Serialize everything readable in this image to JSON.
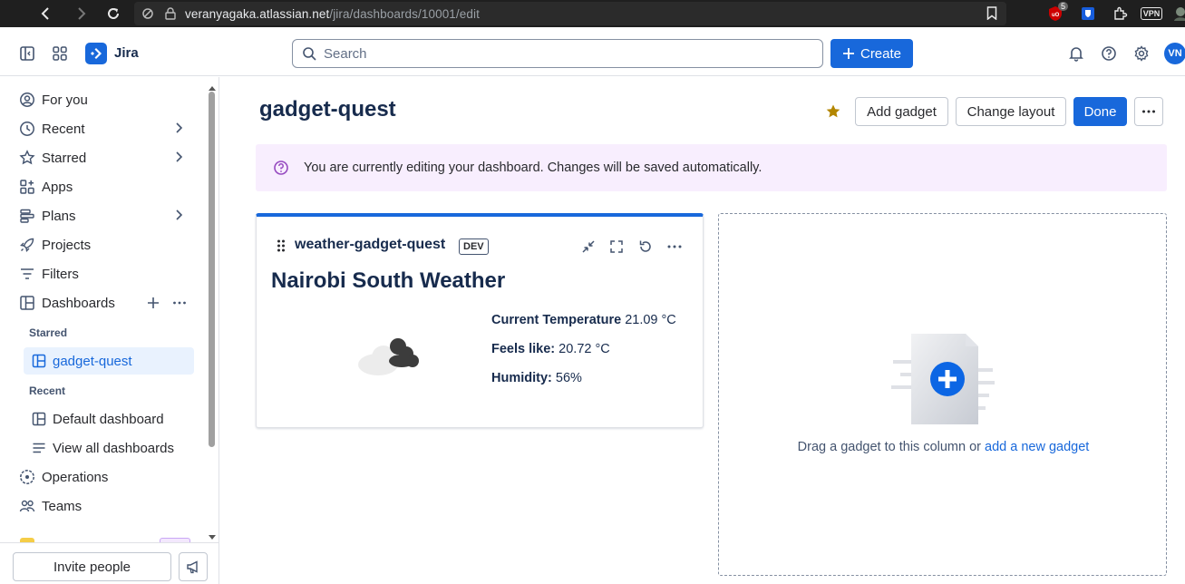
{
  "browser": {
    "url_host": "veranyagaka.atlassian.net",
    "url_path": "/jira/dashboards/10001/edit",
    "ext_badge": "5",
    "vpn_label": "VPN"
  },
  "topnav": {
    "app_name": "Jira",
    "search_placeholder": "Search",
    "create_label": "Create",
    "avatar_initials": "VN"
  },
  "sidebar": {
    "items": [
      {
        "label": "For you"
      },
      {
        "label": "Recent"
      },
      {
        "label": "Starred"
      },
      {
        "label": "Apps"
      },
      {
        "label": "Plans"
      },
      {
        "label": "Projects"
      },
      {
        "label": "Filters"
      },
      {
        "label": "Dashboards"
      }
    ],
    "starred_heading": "Starred",
    "starred_item": "gadget-quest",
    "recent_heading": "Recent",
    "recent_item": "Default dashboard",
    "view_all": "View all dashboards",
    "operations": "Operations",
    "teams": "Teams",
    "invite_label": "Invite people"
  },
  "main": {
    "title": "gadget-quest",
    "add_gadget": "Add gadget",
    "change_layout": "Change layout",
    "done": "Done",
    "banner_text": "You are currently editing your dashboard. Changes will be saved automatically."
  },
  "gadget": {
    "title": "weather-gadget-quest",
    "badge": "DEV",
    "heading": "Nairobi South Weather",
    "temp_label": "Current Temperature",
    "temp_value": "21.09 °C",
    "feels_label": "Feels like:",
    "feels_value": "20.72 °C",
    "humidity_label": "Humidity:",
    "humidity_value": "56%"
  },
  "dropzone": {
    "text": "Drag a gadget to this column or",
    "link": "add a new gadget"
  },
  "colors": {
    "brand": "#1868db",
    "banner_bg": "#f8eefe",
    "star": "#b38600"
  }
}
